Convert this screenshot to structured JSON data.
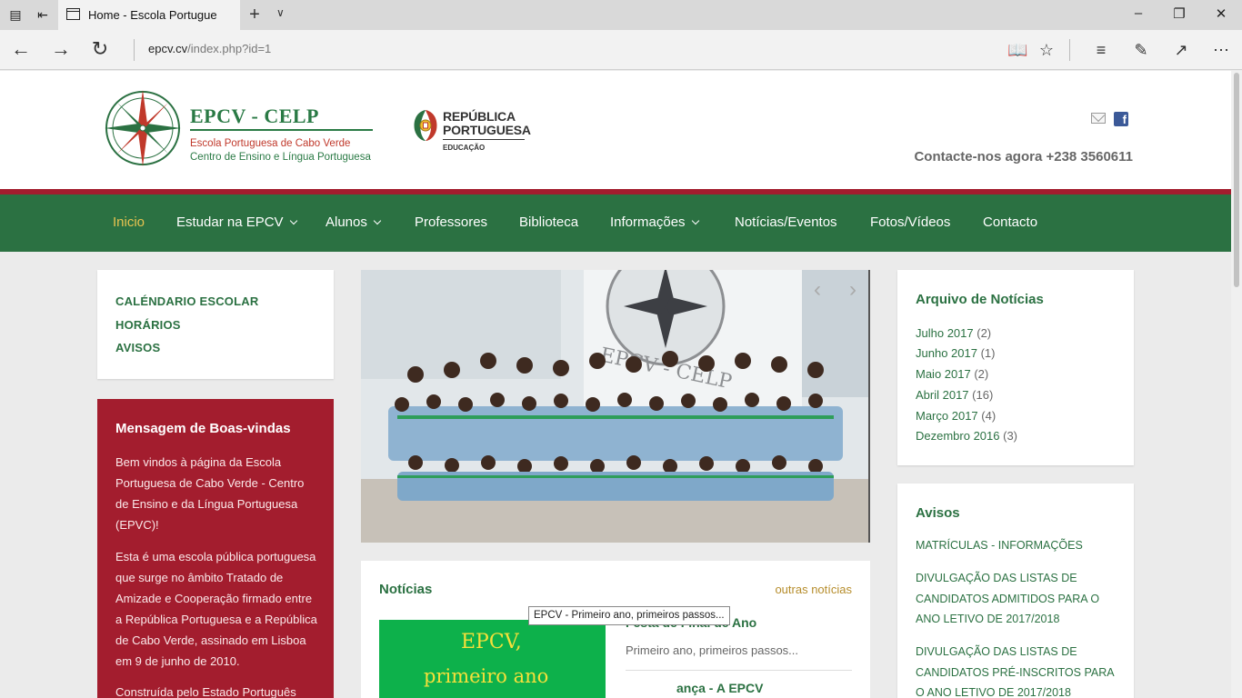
{
  "browser": {
    "tab_title": "Home - Escola Portugue",
    "url_domain": "epcv.cv",
    "url_path": "/index.php?id=1"
  },
  "site": {
    "brand_title": "EPCV - CELP",
    "brand_subtitle_1": "Escola Portuguesa de Cabo Verde",
    "brand_subtitle_2": "Centro de Ensino e Língua Portuguesa",
    "republica_line1": "REPÚBLICA",
    "republica_line2": "PORTUGUESA",
    "republica_line3": "EDUCAÇÃO",
    "contact": "Contacte-nos agora +238 3560611"
  },
  "nav": {
    "items": [
      {
        "label": "Inicio"
      },
      {
        "label": "Estudar na EPCV"
      },
      {
        "label": "Alunos"
      },
      {
        "label": "Professores"
      },
      {
        "label": "Biblioteca"
      },
      {
        "label": "Informações"
      },
      {
        "label": "Notícias/Eventos"
      },
      {
        "label": "Fotos/Vídeos"
      },
      {
        "label": "Contacto"
      }
    ]
  },
  "quick_links": [
    "CALÉNDARIO ESCOLAR",
    "HORÁRIOS",
    "AVISOS"
  ],
  "welcome": {
    "title": "Mensagem de Boas-vindas",
    "p1": "Bem vindos à página da Escola Portuguesa de Cabo Verde - Centro de Ensino e da Língua Portuguesa (EPVC)!",
    "p2": "Esta é uma escola pública portuguesa que surge no âmbito Tratado de Amizade e Cooperação firmado entre a República Portuguesa e a República de Cabo Verde, assinado em Lisboa em 9 de junho de 2010.",
    "p3": "Construída pelo Estado Português"
  },
  "slider": {
    "prev": "‹",
    "next": "›",
    "building_text": "EPCV - CELP"
  },
  "news": {
    "title": "Notícias",
    "more": "outras notícias",
    "thumb_line1": "EPCV,",
    "thumb_line2": "primeiro ano",
    "item1_title": "Festa de Final de Ano",
    "item1_sub": "Primeiro ano, primeiros passos...",
    "item2_title": "ança - A EPCV",
    "tooltip": "EPCV - Primeiro ano, primeiros passos..."
  },
  "archive": {
    "title": "Arquivo de Notícias",
    "items": [
      {
        "month": "Julho 2017",
        "count": "(2)"
      },
      {
        "month": "Junho 2017",
        "count": "(1)"
      },
      {
        "month": "Maio 2017",
        "count": "(2)"
      },
      {
        "month": "Abril 2017",
        "count": "(16)"
      },
      {
        "month": "Março 2017",
        "count": "(4)"
      },
      {
        "month": "Dezembro 2016",
        "count": "(3)"
      }
    ]
  },
  "avisos": {
    "title": "Avisos",
    "items": [
      "MATRÍCULAS - INFORMAÇÕES",
      "DIVULGAÇÃO DAS LISTAS DE CANDIDATOS ADMITIDOS PARA O ANO LETIVO DE 2017/2018",
      "DIVULGAÇÃO DAS LISTAS DE CANDIDATOS PRÉ-INSCRITOS PARA O ANO LETIVO DE 2017/2018"
    ]
  },
  "colors": {
    "green": "#2b7142",
    "red": "#a31d2e",
    "gold": "#e7c350"
  }
}
